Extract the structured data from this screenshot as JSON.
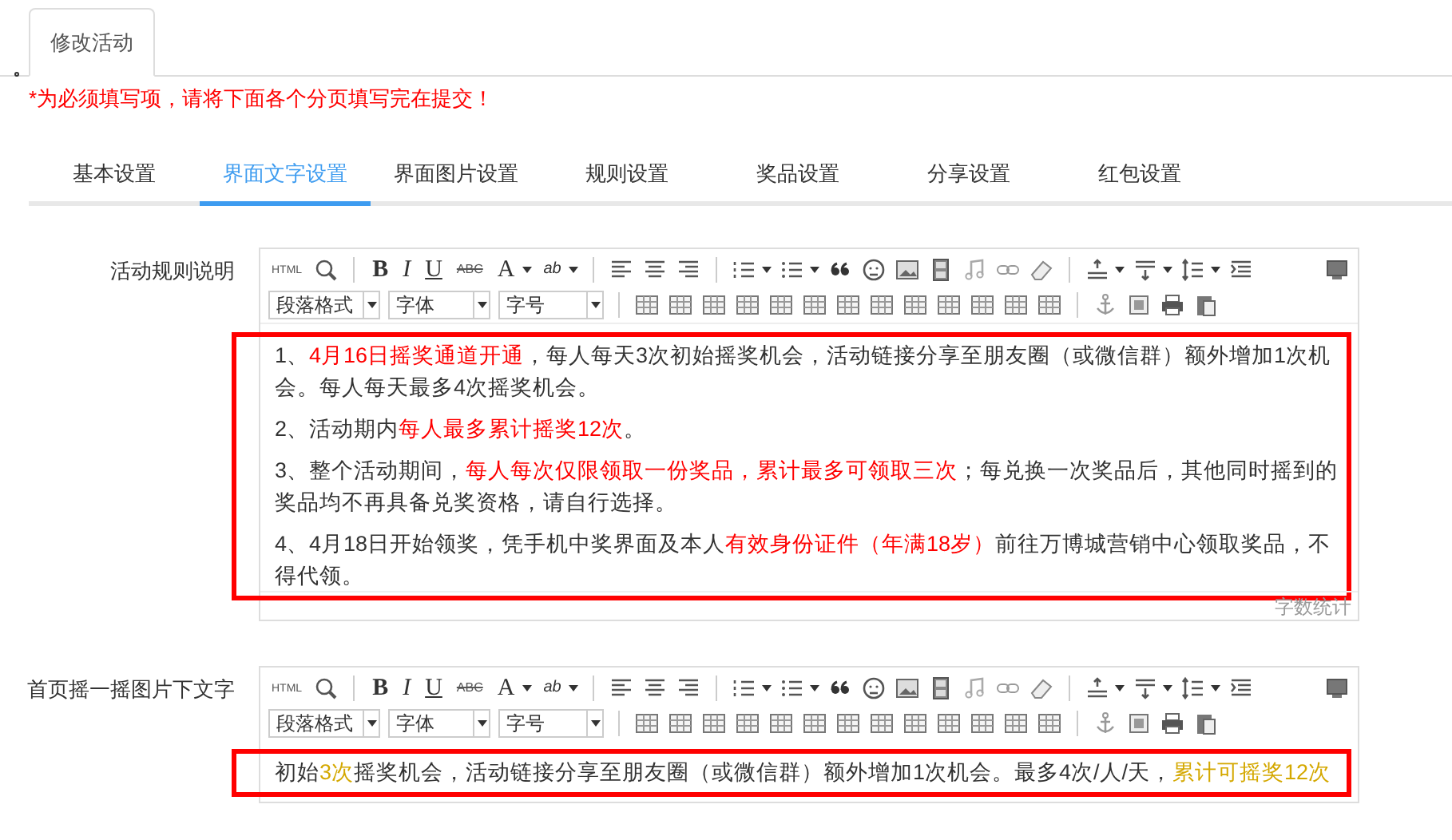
{
  "top_tab": {
    "label": "修改活动"
  },
  "notice": "*为必须填写项，请将下面各个分页填写完在提交！",
  "tabs": [
    {
      "label": "基本设置",
      "selected": false
    },
    {
      "label": "界面文字设置",
      "selected": true
    },
    {
      "label": "界面图片设置",
      "selected": false
    },
    {
      "label": "规则设置",
      "selected": false
    },
    {
      "label": "奖品设置",
      "selected": false
    },
    {
      "label": "分享设置",
      "selected": false
    },
    {
      "label": "红包设置",
      "selected": false
    }
  ],
  "fields": [
    {
      "label": "活动规则说明",
      "toolbar": {
        "glyphs": [
          "HTML",
          "B",
          "I",
          "U",
          "ABC",
          "A",
          "ab"
        ],
        "dropdowns": [
          "段落格式",
          "字体",
          "字号"
        ]
      },
      "word_count": "字数统计",
      "annotated": true,
      "paragraphs": [
        [
          {
            "text": "1、"
          },
          {
            "text": "4月16日摇奖通道开通",
            "color": "#ff0000"
          },
          {
            "text": "，每人每天3次初始摇奖机会，活动链接分享至朋友圈（或微信群）额外增加1次机会。每人每天最多4次摇奖机会。"
          }
        ],
        [
          {
            "text": "2、活动期内"
          },
          {
            "text": "每人最多累计摇奖12次",
            "color": "#ff0000"
          },
          {
            "text": "。"
          }
        ],
        [
          {
            "text": "3、整个活动期间，"
          },
          {
            "text": "每人每次仅限领取一份奖品，累计最多可领取三次",
            "color": "#ff0000"
          },
          {
            "text": "；每兑换一次奖品后，其他同时摇到的奖品均不再具备兑奖资格，请自行选择。"
          }
        ],
        [
          {
            "text": "4、4月18日开始领奖，凭手机中奖界面及本人"
          },
          {
            "text": "有效身份证件（年满18岁）",
            "color": "#ff0000"
          },
          {
            "text": "前往万博城营销中心领取奖品，不得代领。"
          }
        ]
      ]
    },
    {
      "label": "首页摇一摇图片下文字",
      "toolbar": {
        "glyphs": [
          "HTML",
          "B",
          "I",
          "U",
          "ABC",
          "A",
          "ab"
        ],
        "dropdowns": [
          "段落格式",
          "字体",
          "字号"
        ]
      },
      "annotated": true,
      "paragraphs": [
        [
          {
            "text": "初始"
          },
          {
            "text": "3次",
            "color": "#d4a800"
          },
          {
            "text": "摇奖机会，活动链接分享至朋友圈（或微信群）额外增加1次机会。最多4次/人/天，"
          },
          {
            "text": "累计可摇奖12次",
            "color": "#d4a800"
          }
        ]
      ]
    }
  ]
}
